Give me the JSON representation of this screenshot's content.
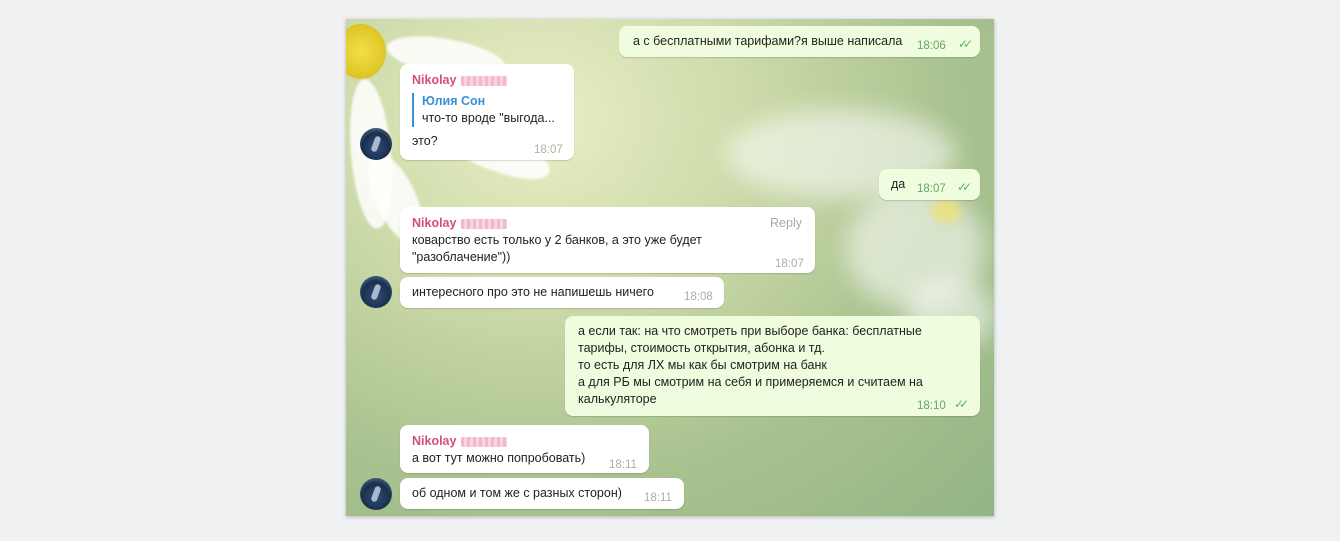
{
  "messages": [
    {
      "id": "m1",
      "direction": "out",
      "text": "а с бесплатными тарифами?я выше написала",
      "time": "18:06"
    },
    {
      "id": "m2",
      "direction": "in",
      "sender": "Nikolay",
      "quote_author": "Юлия Сон",
      "quote_text": "что-то вроде \"выгода...",
      "text": "это?",
      "time": "18:07"
    },
    {
      "id": "m3",
      "direction": "out",
      "text": "да",
      "time": "18:07"
    },
    {
      "id": "m4",
      "direction": "in",
      "sender": "Nikolay",
      "reply_label": "Reply",
      "lines": [
        "коварство есть только у 2 банков, а это уже будет",
        "\"разоблачение\"))"
      ],
      "time": "18:07"
    },
    {
      "id": "m5",
      "direction": "in",
      "text": "интересного про это не напишешь ничего",
      "time": "18:08"
    },
    {
      "id": "m6",
      "direction": "out",
      "lines": [
        "а если так: на что смотреть при выборе банка: бесплатные",
        "тарифы, стоимость открытия, абонка и тд.",
        "то есть для ЛХ мы как бы смотрим на банк",
        "а для РБ мы смотрим на себя и примеряемся и считаем на",
        "калькуляторе"
      ],
      "time": "18:10"
    },
    {
      "id": "m7",
      "direction": "in",
      "sender": "Nikolay",
      "text": "а вот тут можно попробовать)",
      "time": "18:11"
    },
    {
      "id": "m8",
      "direction": "in",
      "text": "об одном и том же с разных сторон)",
      "time": "18:11"
    }
  ],
  "colors": {
    "outgoing_bubble": "#effdde",
    "incoming_bubble": "#ffffff",
    "sender_name": "#d2507a",
    "quote_accent": "#3a8fd6",
    "read_checks": "#5fb55a"
  },
  "icons": {
    "read_status": "double-check-icon",
    "avatar": "user-avatar"
  }
}
